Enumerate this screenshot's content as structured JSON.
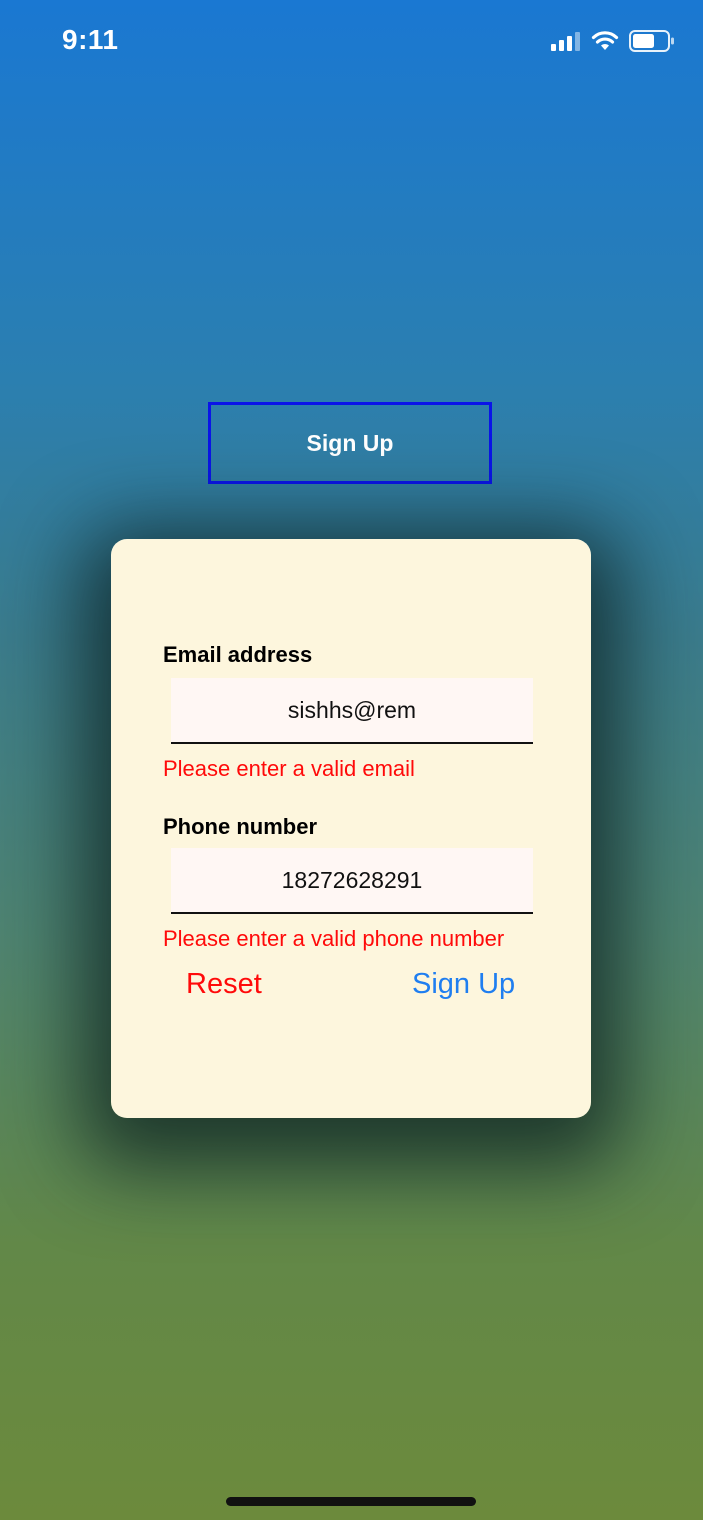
{
  "status_bar": {
    "time": "9:11"
  },
  "signup_trigger": {
    "label": "Sign Up"
  },
  "form": {
    "email": {
      "label": "Email address",
      "value": "sishhs@rem",
      "error": "Please enter a valid email"
    },
    "phone": {
      "label": "Phone number",
      "value": "18272628291",
      "error": "Please enter a valid phone number"
    },
    "reset_label": "Reset",
    "submit_label": "Sign Up"
  },
  "colors": {
    "accent_blue": "#1f7ef0",
    "error_red": "#ff0a0a",
    "card_background": "#fdf6dd",
    "trigger_border": "#0a14e8"
  },
  "icons": [
    "cellular-signal-icon",
    "wifi-icon",
    "battery-icon"
  ]
}
